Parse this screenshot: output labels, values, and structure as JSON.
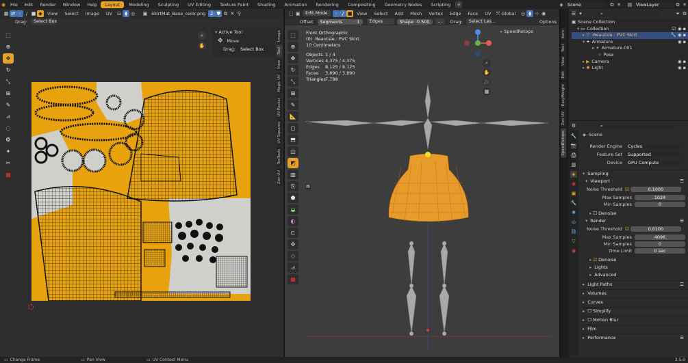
{
  "topbar": {
    "menus": [
      "File",
      "Edit",
      "Render",
      "Window",
      "Help"
    ],
    "workspaces": [
      "Layout",
      "Modeling",
      "Sculpting",
      "UV Editing",
      "Texture Paint",
      "Shading",
      "Animation",
      "Rendering",
      "Compositing",
      "Geometry Nodes",
      "Scripting"
    ],
    "add_tab_icon": "+",
    "scene_label": "Scene",
    "viewlayer_label": "ViewLayer"
  },
  "uv_editor": {
    "menus": [
      "View",
      "Select",
      "Image",
      "UV"
    ],
    "image_name": "SkirtMat_Base_color.png",
    "drag_label": "Drag:",
    "drag_value": "Select Box",
    "active_tool_title": "Active Tool",
    "active_tool_name": "Move",
    "side_tabs": [
      "Image",
      "Tool",
      "View",
      "Magic UV",
      "UV-Packer",
      "UV Squares",
      "TexTools",
      "Zen UV"
    ],
    "colors": {
      "texture_orange": "#e8a20e",
      "texture_gray": "#cfd0cc"
    }
  },
  "viewport": {
    "mode": "Edit Mode",
    "menus": [
      "View",
      "Select",
      "Add",
      "Mesh",
      "Vertex",
      "Edge",
      "Face",
      "UV"
    ],
    "transform_orientation": "Global",
    "options_label": "Options",
    "toolbar2": {
      "offset_label": "Offset",
      "segments_label": "Segments",
      "segments_value": "1",
      "edges_label": "Edges",
      "shape_label": "Shape",
      "shape_value": "0.500",
      "drag_label": "Drag:",
      "drag_value": "Select Las..."
    },
    "overlay_title": "Front Orthographic",
    "overlay_object": "(0) .Beautsie.: PVC Skirt",
    "overlay_scale": "10 Centimeters",
    "stats": [
      {
        "label": "Objects",
        "value": "1 / 4"
      },
      {
        "label": "Vertices",
        "value": "4,375 / 4,375"
      },
      {
        "label": "Edges",
        "value": "8,125 / 8,125"
      },
      {
        "label": "Faces",
        "value": "3,890 / 3,890"
      },
      {
        "label": "Triangles",
        "value": "7,788"
      }
    ],
    "addon_panel": "SpeedRetopo",
    "side_tabs": [
      "Item",
      "Tool",
      "View",
      "Edit",
      "EasyWeight",
      "Zen UV",
      "SpeedRetopo"
    ],
    "colors": {
      "skirt": "#e89a2a",
      "armature": "#a8a8a8",
      "bg": "#3d3d3d"
    }
  },
  "outliner": {
    "root": "Scene Collection",
    "items": [
      {
        "name": "Collection",
        "indent": 0
      },
      {
        "name": ".Beautsie.: PVC Skirt",
        "indent": 1,
        "selected": true
      },
      {
        "name": "Armature",
        "indent": 1
      },
      {
        "name": "Armature.001",
        "indent": 2
      },
      {
        "name": "Pose",
        "indent": 2
      },
      {
        "name": "Camera",
        "indent": 1
      },
      {
        "name": "Light",
        "indent": 1
      }
    ]
  },
  "properties": {
    "context": "Scene",
    "render_engine_label": "Render Engine",
    "render_engine": "Cycles",
    "feature_set_label": "Feature Set",
    "feature_set": "Supported",
    "device_label": "Device",
    "device": "GPU Compute",
    "sampling_label": "Sampling",
    "viewport_label": "Viewport",
    "vp_noise_label": "Noise Threshold",
    "vp_noise": "0.1000",
    "vp_max_label": "Max Samples",
    "vp_max": "1024",
    "vp_min_label": "Min Samples",
    "vp_min": "0",
    "denoise_label": "Denoise",
    "render_label": "Render",
    "r_noise_label": "Noise Threshold",
    "r_noise": "0.0100",
    "r_max_label": "Max Samples",
    "r_max": "4096",
    "r_min_label": "Min Samples",
    "r_min": "0",
    "time_limit_label": "Time Limit",
    "time_limit": "0 sec",
    "denoise2_label": "Denoise",
    "lights_label": "Lights",
    "advanced_label": "Advanced",
    "sections": [
      "Light Paths",
      "Volumes",
      "Curves",
      "Simplify",
      "Motion Blur",
      "Film",
      "Performance"
    ]
  },
  "statusbar": {
    "items": [
      "Change Frame",
      "Pan View",
      "UV Context Menu"
    ],
    "version": "3.5.0"
  }
}
